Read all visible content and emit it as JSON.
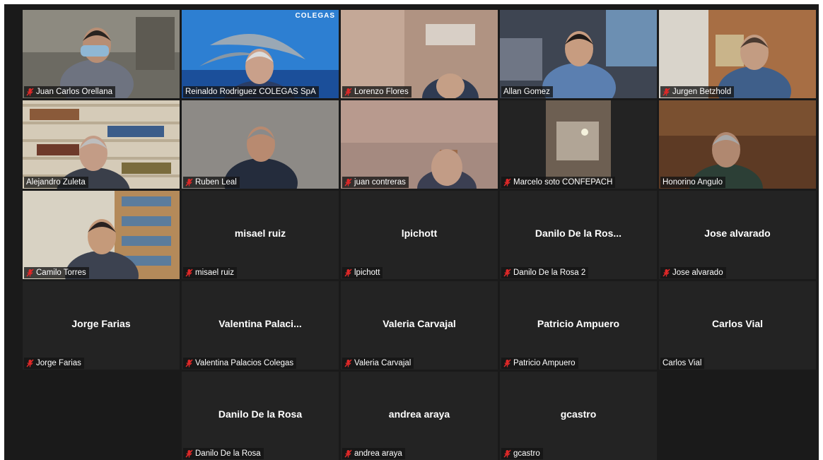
{
  "meeting": {
    "colors": {
      "background": "#1a1a1a",
      "tile": "#232323",
      "active_border": "#d5e34f",
      "mute": "#e02828",
      "text": "#ffffff"
    },
    "tiles": [
      {
        "label": "Juan Carlos Orellana",
        "muted": true,
        "video": true,
        "scene": "office"
      },
      {
        "label": "Reinaldo Rodriguez  COLEGAS SpA",
        "muted": false,
        "video": true,
        "scene": "dolphins",
        "banner": "COLEGAS"
      },
      {
        "label": "Lorenzo Flores",
        "muted": true,
        "video": true,
        "scene": "room"
      },
      {
        "label": "Allan Gomez",
        "muted": false,
        "video": true,
        "scene": "office2",
        "active": true
      },
      {
        "label": "Jurgen Betzhold",
        "muted": true,
        "video": true,
        "scene": "office3"
      },
      {
        "label": "Alejandro Zuleta",
        "muted": false,
        "video": true,
        "scene": "library"
      },
      {
        "label": "Ruben Leal",
        "muted": true,
        "video": true,
        "scene": "wall"
      },
      {
        "label": "juan contreras",
        "muted": true,
        "video": true,
        "scene": "room2"
      },
      {
        "label": "Marcelo soto CONFEPACH",
        "muted": true,
        "video": true,
        "scene": "hall"
      },
      {
        "label": "Honorino Angulo",
        "muted": false,
        "video": true,
        "scene": "wood"
      },
      {
        "label": "Camilo Torres",
        "muted": true,
        "video": true,
        "scene": "study"
      },
      {
        "label": "misael ruiz",
        "display": "misael ruiz",
        "muted": true,
        "video": false
      },
      {
        "label": "lpichott",
        "display": "lpichott",
        "muted": true,
        "video": false
      },
      {
        "label": "Danilo De la Rosa 2",
        "display": "Danilo De la Ros...",
        "muted": true,
        "video": false
      },
      {
        "label": "Jose alvarado",
        "display": "Jose alvarado",
        "muted": true,
        "video": false
      },
      {
        "label": "Jorge Farias",
        "display": "Jorge Farias",
        "muted": true,
        "video": false
      },
      {
        "label": "Valentina Palacios Colegas",
        "display": "Valentina  Palaci...",
        "muted": true,
        "video": false
      },
      {
        "label": "Valeria Carvajal",
        "display": "Valeria Carvajal",
        "muted": true,
        "video": false
      },
      {
        "label": "Patricio Ampuero",
        "display": "Patricio Ampuero",
        "muted": true,
        "video": false
      },
      {
        "label": "Carlos Vial",
        "display": "Carlos Vial",
        "muted": false,
        "video": false
      },
      {
        "empty": true
      },
      {
        "label": "Danilo De la Rosa",
        "display": "Danilo De la Rosa",
        "muted": true,
        "video": false
      },
      {
        "label": "andrea araya",
        "display": "andrea araya",
        "muted": true,
        "video": false
      },
      {
        "label": "gcastro",
        "display": "gcastro",
        "muted": true,
        "video": false
      },
      {
        "empty": true
      }
    ]
  }
}
